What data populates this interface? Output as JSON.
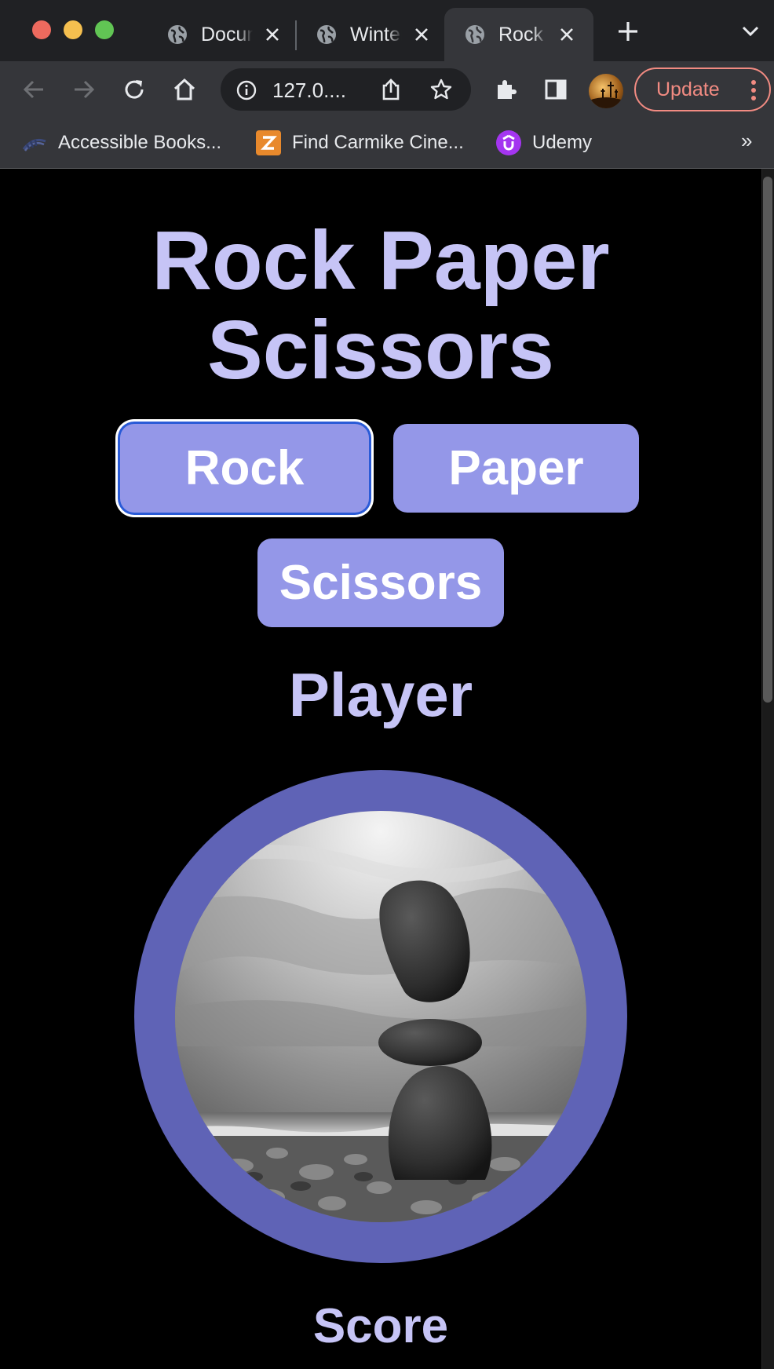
{
  "browser": {
    "tabs": [
      {
        "title": "Document",
        "active": false
      },
      {
        "title": "Winter",
        "active": false
      },
      {
        "title": "Rock Paper Scissors",
        "active": true
      }
    ],
    "address": "127.0....",
    "update_label": "Update",
    "bookmarks": [
      {
        "label": "Accessible Books...",
        "icon": "books-icon"
      },
      {
        "label": "Find Carmike Cine...",
        "icon": "carmike-icon"
      },
      {
        "label": "Udemy",
        "icon": "udemy-icon"
      }
    ],
    "more_bookmarks": "»"
  },
  "game": {
    "title": "Rock Paper Scissors",
    "choices": {
      "rock": "Rock",
      "paper": "Paper",
      "scissors": "Scissors"
    },
    "player_label": "Player",
    "player_choice_image": "stacked-rocks-photo",
    "score_label": "Score"
  },
  "colors": {
    "heading": "#c6c4f6",
    "button": "#9497e8",
    "ring": "#5f63b6",
    "background": "#000000"
  }
}
